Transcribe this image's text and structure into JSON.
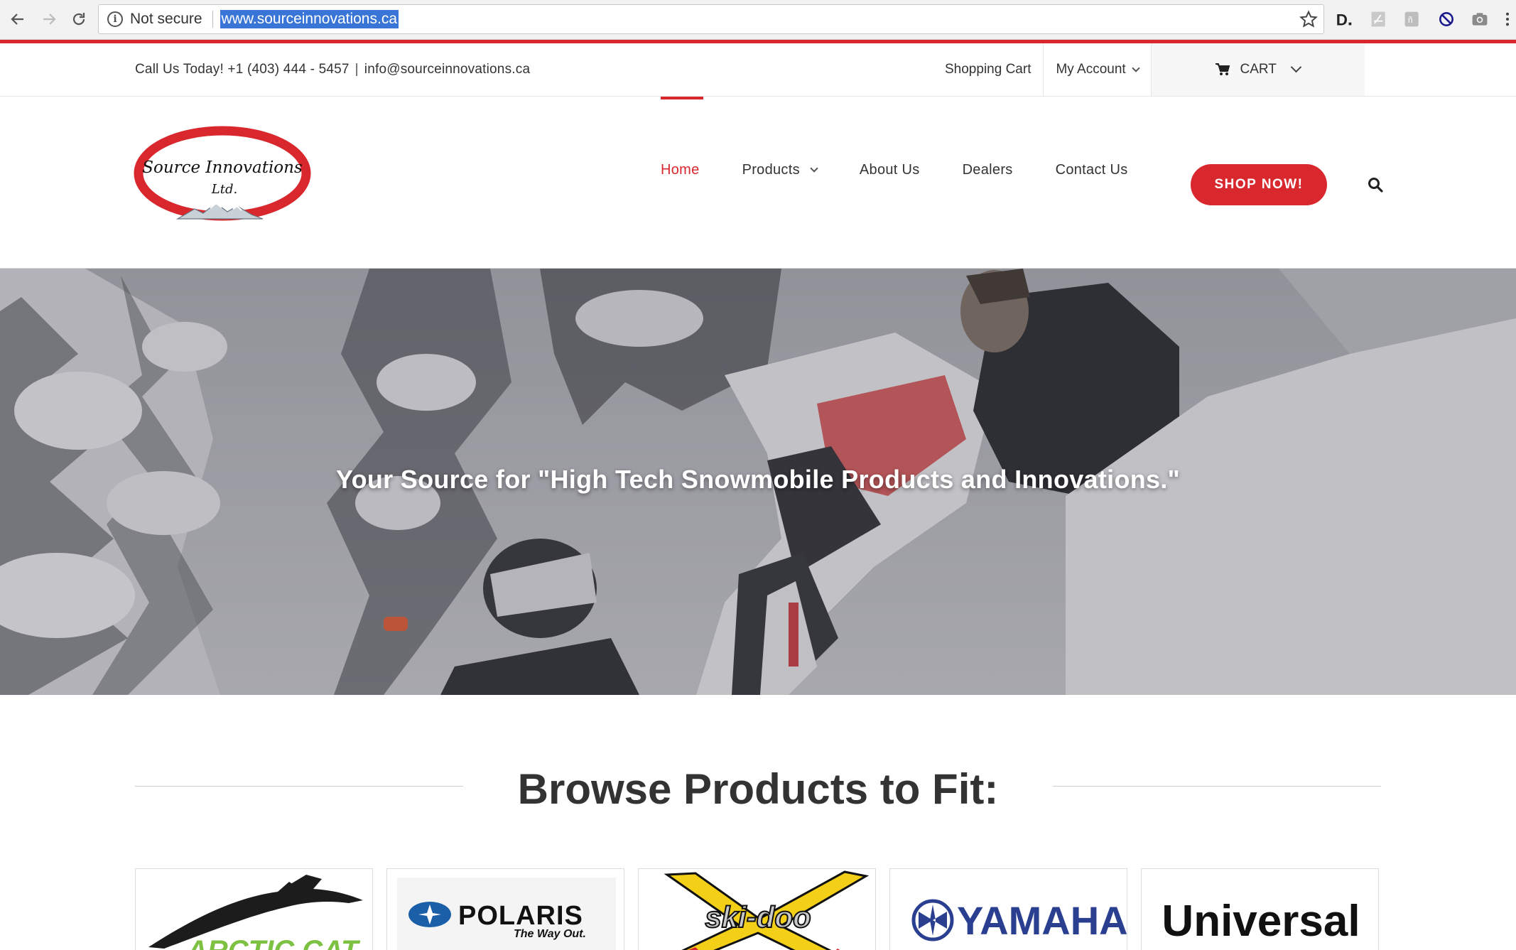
{
  "browser": {
    "security_label": "Not secure",
    "url": "www.sourceinnovations.ca",
    "icons": [
      "back-arrow-icon",
      "forward-arrow-icon",
      "reload-icon",
      "info-icon",
      "star-icon",
      "extension-d-icon",
      "extension-pdf-icon",
      "extension-translate-icon",
      "extension-block-icon",
      "extension-camera-icon",
      "menu-dots-icon"
    ]
  },
  "topbar": {
    "phone": "Call Us Today! +1 (403) 444 - 5457",
    "separator": "|",
    "email": "info@sourceinnovations.ca",
    "shopping_cart": "Shopping Cart",
    "my_account": "My Account",
    "cart": "CART"
  },
  "header": {
    "logo_text_line1": "Source Innovations",
    "logo_text_line2": "Ltd.",
    "nav": [
      {
        "label": "Home",
        "active": true
      },
      {
        "label": "Products",
        "active": false
      },
      {
        "label": "About Us",
        "active": false
      },
      {
        "label": "Dealers",
        "active": false
      },
      {
        "label": "Contact Us",
        "active": false
      }
    ],
    "shop_button": "SHOP NOW!"
  },
  "hero": {
    "headline": "Your Source for \"High Tech Snowmobile Products and Innovations.\""
  },
  "browse": {
    "title": "Browse Products to Fit:",
    "brands": [
      {
        "name": "ARCTIC CAT"
      },
      {
        "name": "POLARIS",
        "tagline": "The Way Out."
      },
      {
        "name": "ski-doo"
      },
      {
        "name": "YAMAHA"
      },
      {
        "name": "Universal"
      }
    ]
  },
  "colors": {
    "accent": "#d9272e",
    "text": "#333333",
    "hero_overlay": "#6f6f78"
  }
}
